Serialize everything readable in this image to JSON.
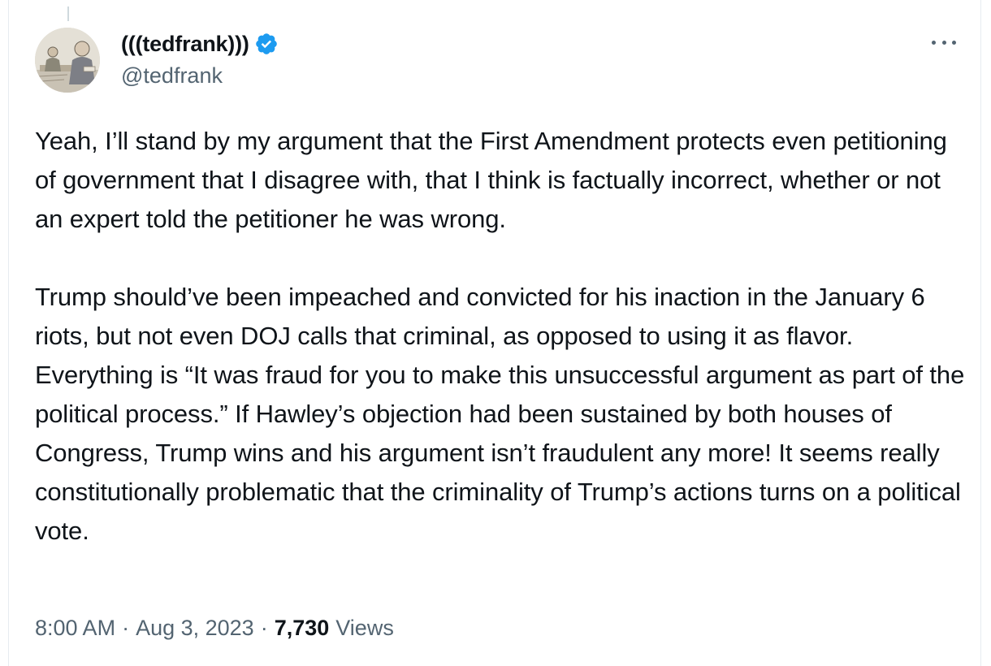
{
  "author": {
    "display_name": "(((tedfrank)))",
    "handle": "@tedfrank",
    "verified": true,
    "avatar_icon": "courtroom-sketch-avatar"
  },
  "menu": {
    "icon": "more-horizontal-icon"
  },
  "tweet": {
    "paragraphs": [
      "Yeah, I’ll stand by my argument that the First Amendment protects even petitioning of government that I disagree with, that I think is factually incorrect, whether or not an expert told the petitioner he was wrong.",
      "Trump should’ve been impeached and convicted for his inaction in the January 6 riots, but not even DOJ calls that criminal, as opposed to using it as flavor. Everything is “It was fraud for you to make this unsuccessful argument as part of the political process.” If Hawley’s objection had been sustained by both houses of Congress, Trump wins and his argument isn’t fraudulent any more! It seems really constitutionally problematic that the criminality of Trump’s actions turns on a political vote."
    ]
  },
  "meta": {
    "time": "8:00 AM",
    "separator": "·",
    "date": "Aug 3, 2023",
    "views_count": "7,730",
    "views_label": "Views"
  },
  "colors": {
    "text": "#0f1419",
    "secondary": "#536471",
    "verified_blue": "#1d9bf0",
    "border": "#e6ecf0"
  }
}
